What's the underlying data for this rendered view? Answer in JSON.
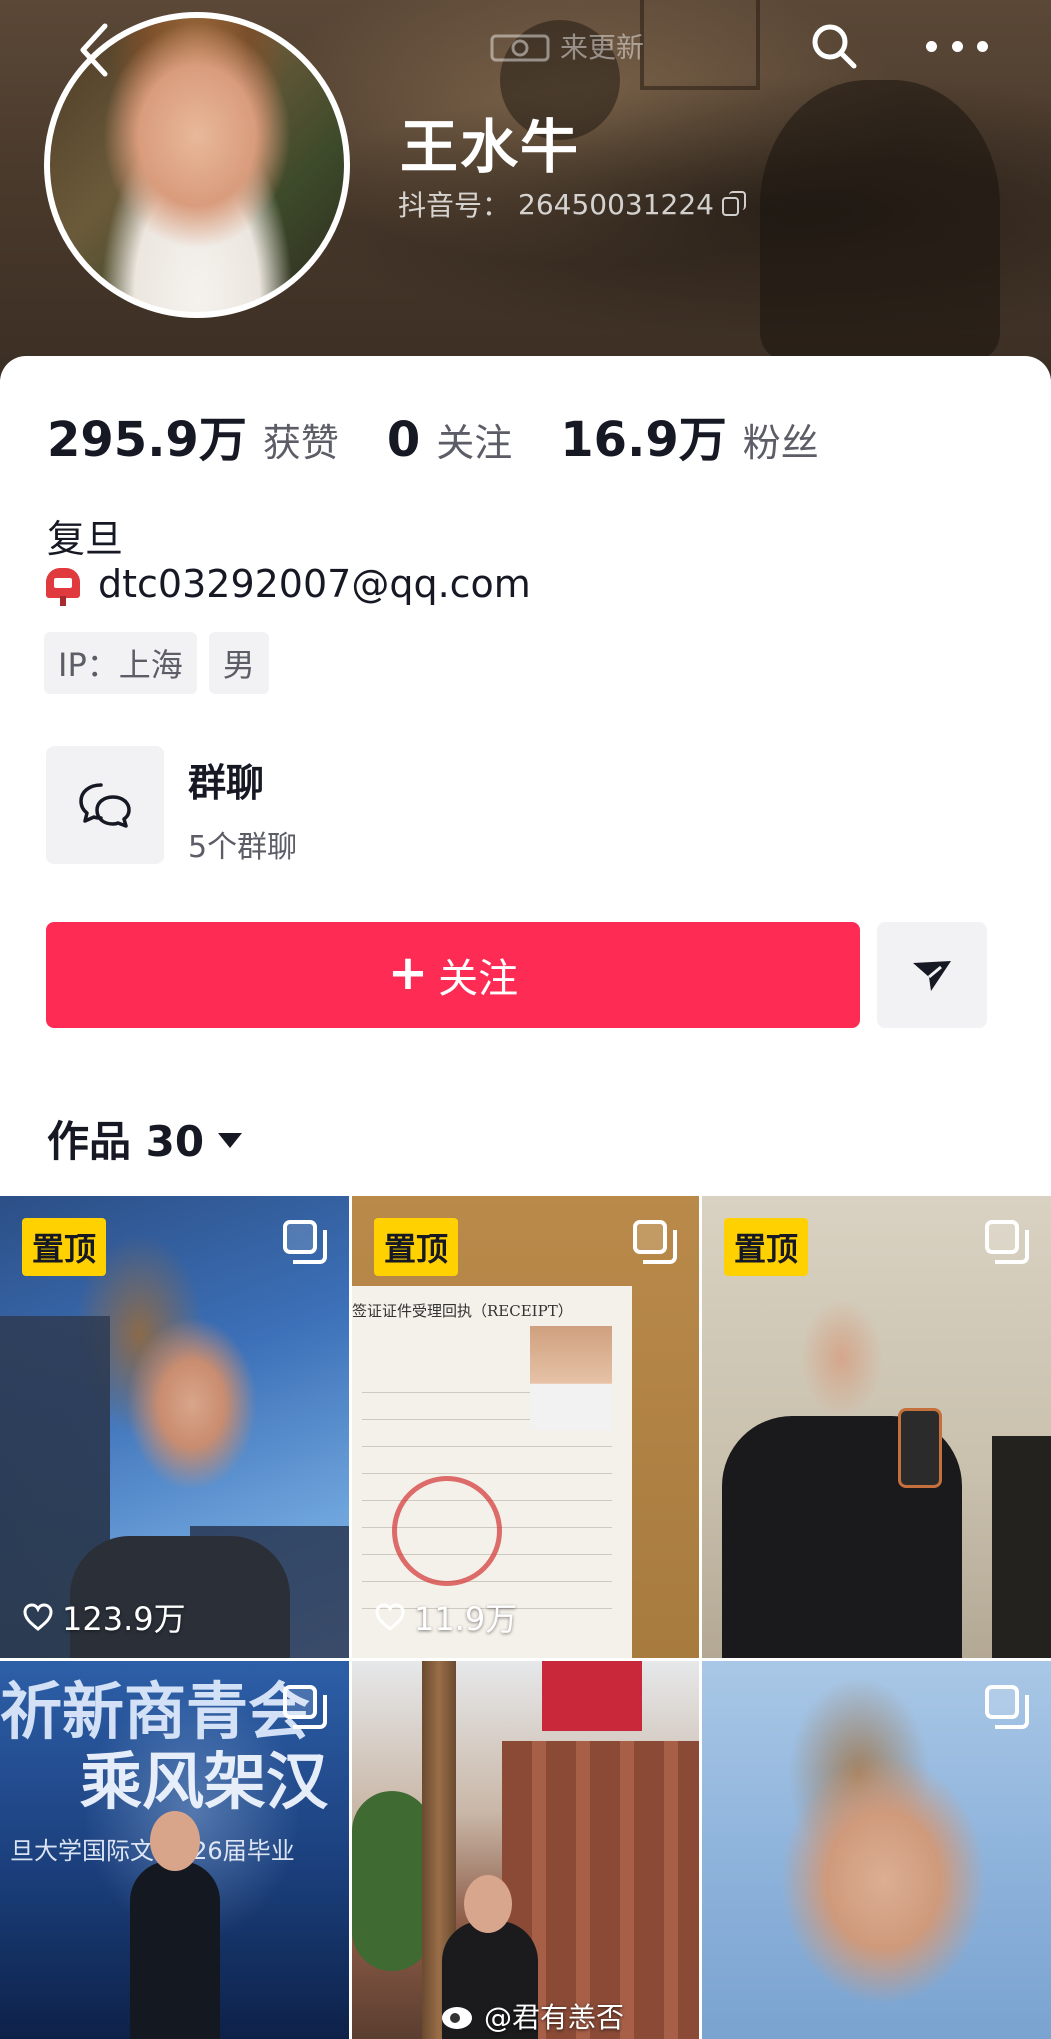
{
  "nav": {
    "refresh_hint": "来更新"
  },
  "profile": {
    "name": "王水牛",
    "id_label": "抖音号：",
    "id_value": "26450031224"
  },
  "stats": [
    {
      "value": "295.9万",
      "label": "获赞"
    },
    {
      "value": "0",
      "label": "关注"
    },
    {
      "value": "16.9万",
      "label": "粉丝"
    }
  ],
  "bio": {
    "school": "复旦",
    "email": "dtc03292007@qq.com",
    "tags": [
      "IP：上海",
      "男"
    ]
  },
  "group_chat": {
    "title": "群聊",
    "subtitle": "5个群聊"
  },
  "actions": {
    "follow_plus": "+",
    "follow_label": "关注"
  },
  "works": {
    "label": "作品 30"
  },
  "videos": [
    {
      "pinned": true,
      "pin_label": "置顶",
      "likes": "123.9万",
      "multi": true
    },
    {
      "pinned": true,
      "pin_label": "置顶",
      "likes": "11.9万",
      "multi": true,
      "receipt_text": "签证证件受理回执（RECEIPT）"
    },
    {
      "pinned": true,
      "pin_label": "置顶",
      "likes": "",
      "multi": true
    },
    {
      "pinned": false,
      "likes": "",
      "multi": true,
      "caption_line1": "祈新商青会",
      "caption_line2": "乘风架汉",
      "caption_line3": "旦大学国际文 2026届毕业"
    },
    {
      "pinned": false,
      "likes": "",
      "multi": false
    },
    {
      "pinned": false,
      "likes": "",
      "multi": true
    }
  ],
  "watermark": "@君有恙否",
  "colors": {
    "accent": "#fe2c55",
    "pin_badge": "#ffd100",
    "text_primary": "#161823",
    "text_secondary": "#5c5d66"
  }
}
